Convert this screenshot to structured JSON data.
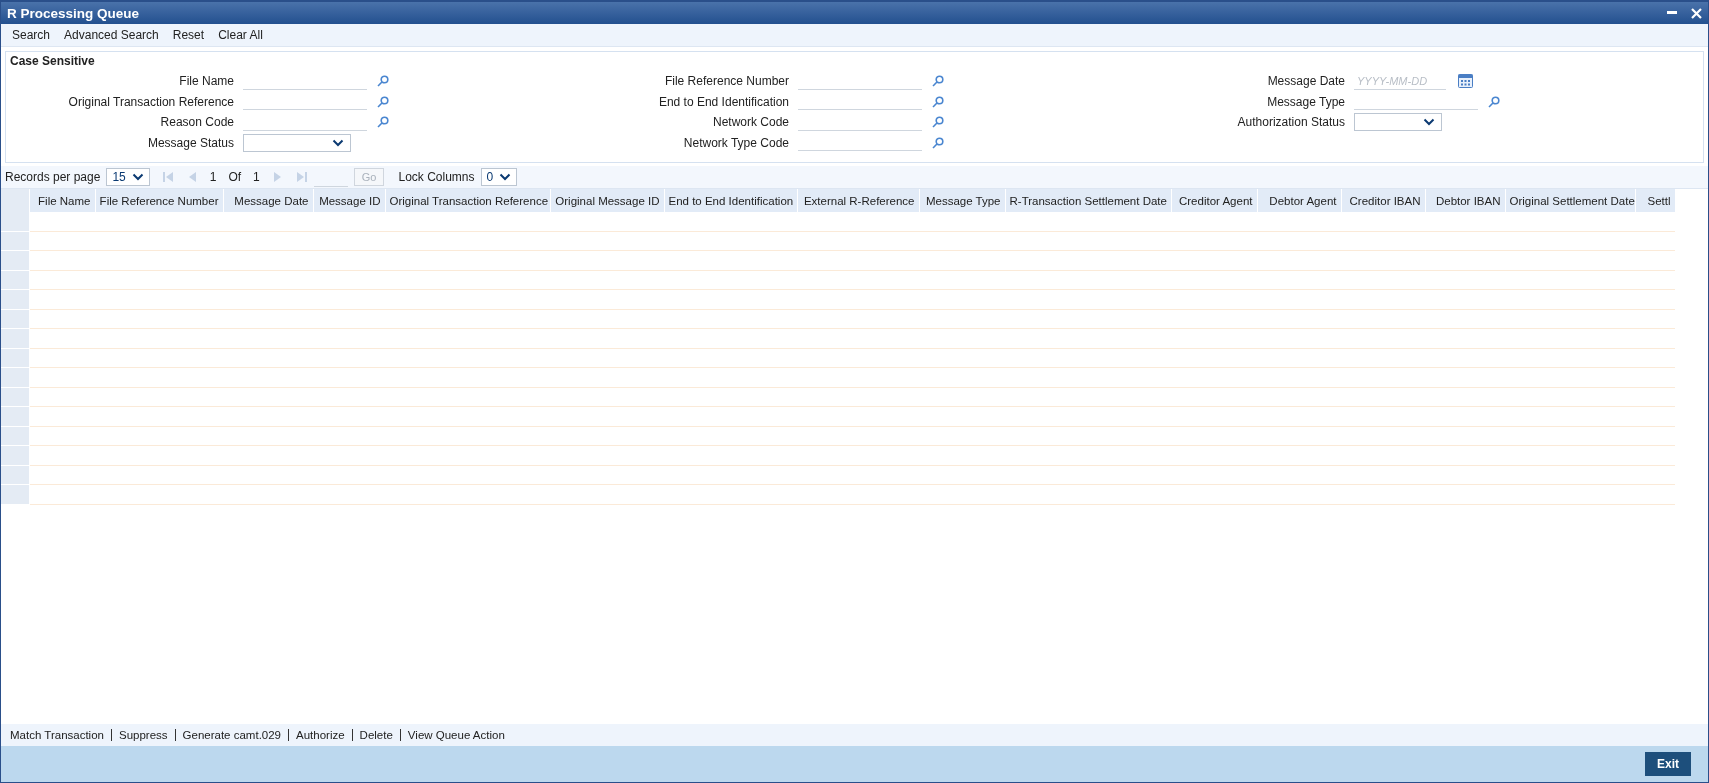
{
  "window": {
    "title": "R Processing Queue"
  },
  "toolbar": [
    "Search",
    "Advanced Search",
    "Reset",
    "Clear All"
  ],
  "search_panel": {
    "legend": "Case Sensitive",
    "columns": [
      [
        {
          "label": "File Name",
          "kind": "lookup"
        },
        {
          "label": "Original Transaction Reference",
          "kind": "lookup"
        },
        {
          "label": "Reason Code",
          "kind": "lookup"
        },
        {
          "label": "Message Status",
          "kind": "select"
        }
      ],
      [
        {
          "label": "File Reference Number",
          "kind": "lookup"
        },
        {
          "label": "End to End Identification",
          "kind": "lookup"
        },
        {
          "label": "Network Code",
          "kind": "lookup"
        },
        {
          "label": "Network Type Code",
          "kind": "lookup"
        }
      ],
      [
        {
          "label": "Message Date",
          "kind": "date",
          "placeholder": "YYYY-MM-DD"
        },
        {
          "label": "Message Type",
          "kind": "lookup"
        },
        {
          "label": "Authorization Status",
          "kind": "select"
        }
      ]
    ]
  },
  "pager": {
    "records_label": "Records per page",
    "records_value": "15",
    "nav": [
      {
        "kind": "first",
        "disabled": true
      },
      {
        "kind": "prev",
        "disabled": true
      }
    ],
    "page": "1",
    "of_label": "Of",
    "total": "1",
    "nav_after": [
      {
        "kind": "next",
        "disabled": true
      },
      {
        "kind": "last",
        "disabled": true
      }
    ],
    "go": {
      "label": "Go",
      "disabled": true
    },
    "lock_label": "Lock Columns",
    "lock_value": "0"
  },
  "table": {
    "columns": [
      "File Name",
      "File Reference Number",
      "Message Date",
      "Message ID",
      "Original Transaction Reference",
      "Original Message ID",
      "End to End Identification",
      "External R-Reference",
      "Message Type",
      "R-Transaction Settlement Date",
      "Creditor Agent",
      "Debtor Agent",
      "Creditor IBAN",
      "Debtor IBAN",
      "Original Settlement Date",
      "Settl"
    ]
  },
  "actions": [
    "Match Transaction",
    "Suppress",
    "Generate camt.029",
    "Authorize",
    "Delete",
    "View Queue Action"
  ],
  "footer": {
    "button": "Exit"
  }
}
